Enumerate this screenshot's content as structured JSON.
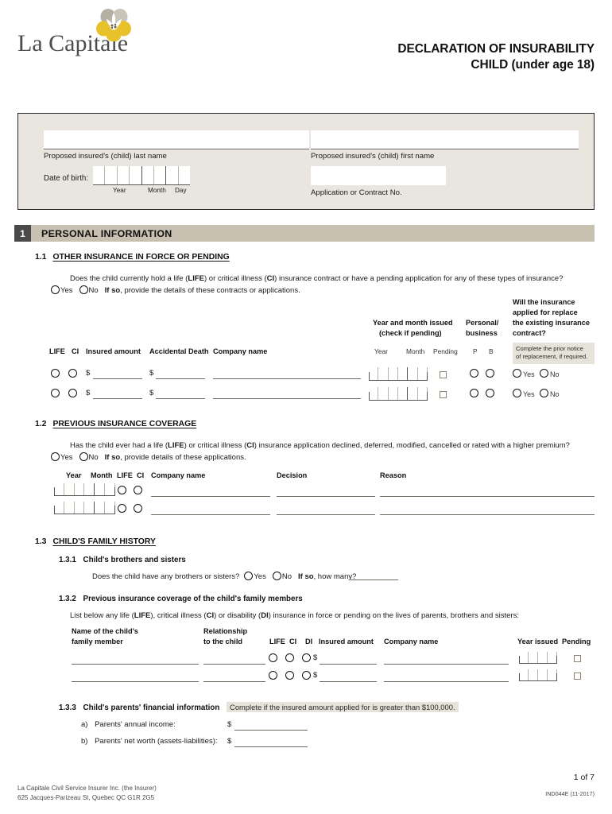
{
  "header": {
    "brand_name": "La Capitale",
    "logo_icon": "flower-logo-icon",
    "title_line1": "DECLARATION OF INSURABILITY",
    "title_line2": "CHILD (under age 18)",
    "colors": {
      "petal_yellow": "#e8c22a",
      "petal_gray": "#b6b0a3",
      "wordmark": "#4d4d4d"
    }
  },
  "identification": {
    "last_name_label": "Proposed insured's (child) last name",
    "last_name_value": "",
    "first_name_label": "Proposed insured's (child) first name",
    "first_name_value": "",
    "dob_label": "Date of birth:",
    "dob_year_label": "Year",
    "dob_month_label": "Month",
    "dob_day_label": "Day",
    "dob_value": "",
    "contract_label": "Application or Contract No.",
    "contract_value": "",
    "box_bg": "#e9e6df"
  },
  "section1": {
    "number": "1",
    "title": "PERSONAL INFORMATION",
    "bar_color": "#c8c0b0",
    "sub11": {
      "number": "1.1",
      "title": "OTHER INSURANCE IN FORCE OR PENDING",
      "question_prefix": "Does the child currently hold a life (",
      "question": "Does the child currently hold a life (LIFE) or critical illness (CI) insurance contract or have a pending application for any of these types of insurance?",
      "yes_label": "Yes",
      "no_label": "No",
      "ifso_bold": "If so",
      "ifso_rest": ", provide the details of these contracts or applications.",
      "headers": {
        "life": "LIFE",
        "ci": "CI",
        "insured_amount": "Insured amount",
        "accidental_death": "Accidental Death",
        "company_name": "Company name",
        "year_month_issued_l1": "Year and month issued",
        "year_month_issued_l2": "(check if pending)",
        "year": "Year",
        "month": "Month",
        "pending": "Pending",
        "personal_business_l1": "Personal/",
        "personal_business_l2": "business",
        "p": "P",
        "b": "B",
        "replace_l1": "Will the insurance",
        "replace_l2": "applied for replace",
        "replace_l3": "the existing insurance",
        "replace_l4": "contract?",
        "note_l1": "Complete the prior notice",
        "note_l2": "of replacement, if required."
      },
      "row_yes": "Yes",
      "row_no": "No",
      "currency": "$",
      "rows": [
        {
          "life": "",
          "ci": "",
          "insured_amount": "",
          "accidental_death": "",
          "company_name": "",
          "year": "",
          "month": "",
          "pending": "",
          "p": "",
          "b": "",
          "replace": ""
        },
        {
          "life": "",
          "ci": "",
          "insured_amount": "",
          "accidental_death": "",
          "company_name": "",
          "year": "",
          "month": "",
          "pending": "",
          "p": "",
          "b": "",
          "replace": ""
        }
      ]
    },
    "sub12": {
      "number": "1.2",
      "title": "PREVIOUS INSURANCE COVERAGE",
      "question": "Has the child ever had a life (LIFE) or critical illness (CI) insurance application declined, deferred, modified, cancelled or rated with a higher premium?",
      "yes_label": "Yes",
      "no_label": "No",
      "ifso_bold": "If so",
      "ifso_rest": ", provide details of these applications.",
      "headers": {
        "year": "Year",
        "month": "Month",
        "life": "LIFE",
        "ci": "CI",
        "company_name": "Company name",
        "decision": "Decision",
        "reason": "Reason"
      },
      "rows": [
        {
          "year": "",
          "month": "",
          "life": "",
          "ci": "",
          "company_name": "",
          "decision": "",
          "reason": ""
        },
        {
          "year": "",
          "month": "",
          "life": "",
          "ci": "",
          "company_name": "",
          "decision": "",
          "reason": ""
        }
      ]
    },
    "sub13": {
      "number": "1.3",
      "title": "CHILD'S FAMILY HISTORY",
      "sub131": {
        "number": "1.3.1",
        "title": "Child's brothers and sisters",
        "question": "Does the child have any brothers or sisters?",
        "yes_label": "Yes",
        "no_label": "No",
        "ifso_bold": "If so",
        "ifso_rest": ", how many?",
        "how_many_value": ""
      },
      "sub132": {
        "number": "1.3.2",
        "title": "Previous insurance coverage of the child's family members",
        "instruction": "List below any life (LIFE), critical illness (CI) or disability (DI) insurance in force or pending on the lives of parents, brothers and sisters:",
        "headers": {
          "name_l1": "Name of the child's",
          "name_l2": "family member",
          "relationship_l1": "Relationship",
          "relationship_l2": "to the child",
          "life": "LIFE",
          "ci": "CI",
          "di": "DI",
          "insured_amount": "Insured amount",
          "company_name": "Company name",
          "year_issued": "Year issued",
          "pending": "Pending"
        },
        "currency": "$",
        "rows": [
          {
            "name": "",
            "relationship": "",
            "life": "",
            "ci": "",
            "di": "",
            "insured_amount": "",
            "company_name": "",
            "year_issued": "",
            "pending": ""
          },
          {
            "name": "",
            "relationship": "",
            "life": "",
            "ci": "",
            "di": "",
            "insured_amount": "",
            "company_name": "",
            "year_issued": "",
            "pending": ""
          }
        ]
      },
      "sub133": {
        "number": "1.3.3",
        "title": "Child's parents' financial information",
        "highlight": "Complete if the insured amount applied for is greater than $100,000.",
        "item_a_marker": "a)",
        "item_a_label": "Parents' annual income:",
        "item_a_currency": "$",
        "item_a_value": "",
        "item_b_marker": "b)",
        "item_b_label": "Parents' net worth (assets-liabilities):",
        "item_b_currency": "$",
        "item_b_value": ""
      }
    }
  },
  "footer": {
    "company_line1": "La Capitale Civil Service Insurer Inc. (the Insurer)",
    "company_line2": "625 Jacques-Parizeau St, Quebec QC  G1R 2G5",
    "page_indicator": "1 of 7",
    "form_code": "IND044E (11-2017)"
  }
}
